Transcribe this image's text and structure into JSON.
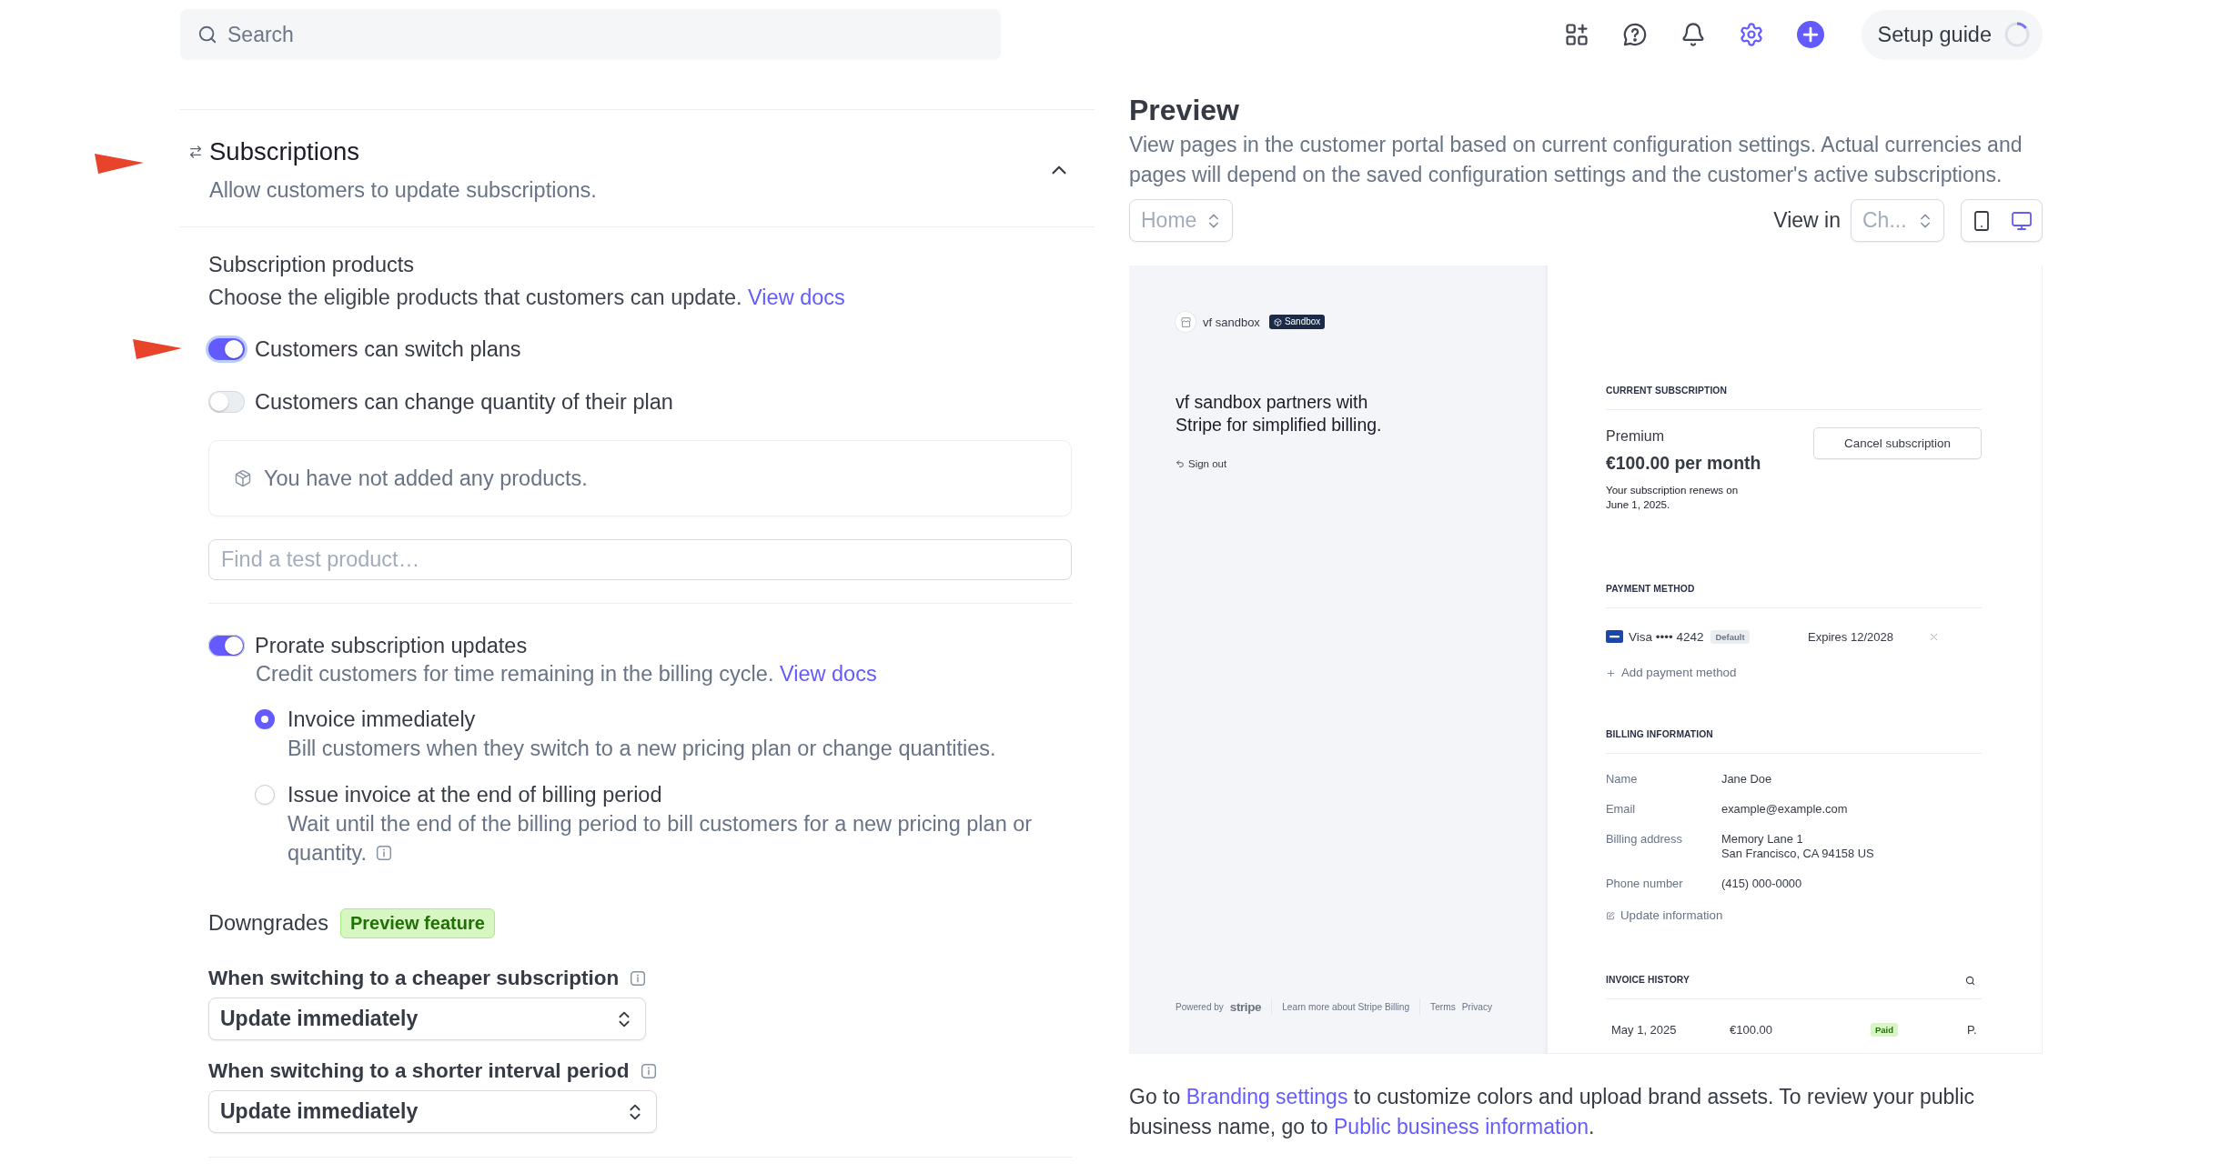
{
  "top_bar": {
    "search": {
      "placeholder": "Search"
    },
    "tools": [
      {
        "selected": false
      },
      {
        "selected": false
      },
      {
        "selected": false
      },
      {
        "selected": true
      }
    ],
    "setup_guide": {
      "label": "Setup guide"
    }
  },
  "settings": {
    "section": {
      "title": "Subscriptions",
      "description": "Allow customers to update subscriptions.",
      "expanded": true
    },
    "products": {
      "title": "Subscription products",
      "description": "Choose the eligible products that customers can update.",
      "link": "View docs"
    },
    "toggles": [
      {
        "label": "Customers can switch plans",
        "on": true,
        "focused": true
      },
      {
        "label": "Customers can change quantity of their plan",
        "on": false,
        "focused": false
      }
    ],
    "empty_state": "You have not added any products.",
    "product_search": {
      "placeholder": "Find a test product…"
    },
    "proration": {
      "label": "Prorate subscription updates",
      "on": true,
      "description": "Credit customers for time remaining in the billing cycle.",
      "link": "View docs",
      "options": [
        {
          "label": "Invoice immediately",
          "description": "Bill customers when they switch to a new pricing plan or change quantities.",
          "selected": true
        },
        {
          "label": "Issue invoice at the end of billing period",
          "description": "Wait until the end of the billing period to bill customers for a new pricing plan or quantity.",
          "selected": false,
          "info": true
        }
      ]
    },
    "downgrades": {
      "title": "Downgrades",
      "badge": "Preview feature",
      "rules": [
        {
          "label": "When switching to a cheaper subscription",
          "value": "Update immediately"
        },
        {
          "label": "When switching to a shorter interval period",
          "value": "Update immediately"
        }
      ]
    }
  },
  "preview": {
    "title": "Preview",
    "description": "View pages in the customer portal based on current configuration settings. Actual currencies and pages will depend on the saved configuration settings and the customer's active subscriptions.",
    "page_select": {
      "value": "Home",
      "disabled": true
    },
    "view_in": {
      "label": "View in",
      "value": "Ch...",
      "disabled": true
    },
    "devices": [
      {
        "selected": false
      },
      {
        "selected": true
      }
    ],
    "portal": {
      "business": {
        "name": "vf sandbox",
        "badge": "Sandbox"
      },
      "headline": "vf sandbox partners with Stripe for simplified billing.",
      "sign_out": "Sign out",
      "footer": {
        "powered_by": "Powered by",
        "brand": "stripe",
        "learn_more": "Learn more about Stripe Billing",
        "legal": [
          "Terms",
          "Privacy"
        ]
      },
      "current_subscription": {
        "heading": "CURRENT SUBSCRIPTION",
        "plan": "Premium",
        "price": "€100.00 per month",
        "renewal": "Your subscription renews on June 1, 2025.",
        "cancel": "Cancel subscription"
      },
      "payment_method": {
        "heading": "PAYMENT METHOD",
        "card": "Visa •••• 4242",
        "badge": "Default",
        "expires": "Expires 12/2028",
        "add": "Add payment method"
      },
      "billing_information": {
        "heading": "BILLING INFORMATION",
        "fields": [
          {
            "label": "Name",
            "lines": [
              "Jane Doe"
            ]
          },
          {
            "label": "Email",
            "lines": [
              "example@example.com"
            ]
          },
          {
            "label": "Billing address",
            "lines": [
              "Memory Lane 1",
              "San Francisco, CA 94158 US"
            ]
          },
          {
            "label": "Phone number",
            "lines": [
              "(415) 000-0000"
            ]
          }
        ],
        "update": "Update information"
      },
      "invoice_history": {
        "heading": "INVOICE HISTORY",
        "rows": [
          {
            "date": "May 1, 2025",
            "amount": "€100.00",
            "status": "Paid",
            "column_4": "P."
          }
        ]
      }
    },
    "note": [
      {
        "kind": "text",
        "text": "Go to "
      },
      {
        "kind": "link",
        "text": "Branding settings"
      },
      {
        "kind": "text",
        "text": " to customize colors and upload brand assets. To review your public business name, go to "
      },
      {
        "kind": "link",
        "text": "Public business information"
      },
      {
        "kind": "text",
        "text": "."
      }
    ]
  }
}
